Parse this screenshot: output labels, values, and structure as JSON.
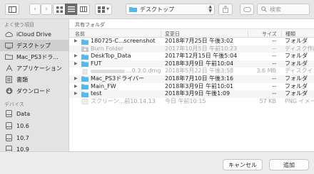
{
  "toolbar": {
    "location": "デスクトップ",
    "search_placeholder": "検索"
  },
  "sidebar": {
    "favorites_header": "よく使う項目",
    "devices_header": "デバイス",
    "favorites": [
      {
        "label": "iCloud Drive",
        "icon": "cloud-icon"
      },
      {
        "label": "デスクトップ",
        "icon": "desktop-icon",
        "selected": true
      },
      {
        "label": "Mac_PS3ドラ...",
        "icon": "folder-icon"
      },
      {
        "label": "アプリケーション",
        "icon": "applications-icon"
      },
      {
        "label": "書類",
        "icon": "document-icon"
      },
      {
        "label": "ダウンロード",
        "icon": "download-icon"
      }
    ],
    "devices": [
      {
        "label": "Data",
        "icon": "disk-icon"
      },
      {
        "label": "10.6",
        "icon": "disk-icon"
      },
      {
        "label": "10.7",
        "icon": "disk-icon"
      },
      {
        "label": "10.9",
        "icon": "disk-icon"
      }
    ]
  },
  "main": {
    "shared_label": "共有フォルダ",
    "columns": {
      "name": "名前",
      "date": "変更日",
      "size": "サイズ",
      "kind": "種類"
    },
    "rows": [
      {
        "name": "180725-C...screenshot",
        "date": "2018年7月25日 午後3:02",
        "size": "--",
        "kind": "フォルダ",
        "type": "folder",
        "dim": false
      },
      {
        "name": "Burn Folder",
        "date": "2017年10月5日 午前10:23",
        "size": "--",
        "kind": "ディスク作成",
        "type": "burn",
        "dim": true
      },
      {
        "name": "DeskTop_Data",
        "date": "2017年12月15日 午後5:04",
        "size": "--",
        "kind": "フォルダ",
        "type": "folder",
        "dim": false
      },
      {
        "name": "FUT",
        "date": "2018年3月9日 午前10:04",
        "size": "--",
        "kind": "フォルダ",
        "type": "folder",
        "dim": false
      },
      {
        "name": "...0.3.0.dmg",
        "date": "2018年5月22日 午後3:58",
        "size": "3.6 MB",
        "kind": "ディスクイメージ",
        "type": "dmg",
        "dim": true
      },
      {
        "name": "Mac_PS3ドライバー",
        "date": "2018年7月10日 午後3:16",
        "size": "--",
        "kind": "フォルダ",
        "type": "folder",
        "dim": false
      },
      {
        "name": "Main_FW",
        "date": "2018年3月9日 午前10:01",
        "size": "--",
        "kind": "フォルダ",
        "type": "folder",
        "dim": false
      },
      {
        "name": "test",
        "date": "2018年3月9日 午後1:09",
        "size": "--",
        "kind": "フォルダ",
        "type": "folder",
        "dim": false
      },
      {
        "name": "スクリーン...前10.14.13",
        "date": "今日 午前10:15",
        "size": "57 KB",
        "kind": "PNG イメージ",
        "type": "image",
        "dim": true
      }
    ]
  },
  "buttons": {
    "cancel": "キャンセル",
    "add": "追加"
  },
  "colors": {
    "folder": "#54b8ee",
    "selection": "#cfcfcf"
  }
}
